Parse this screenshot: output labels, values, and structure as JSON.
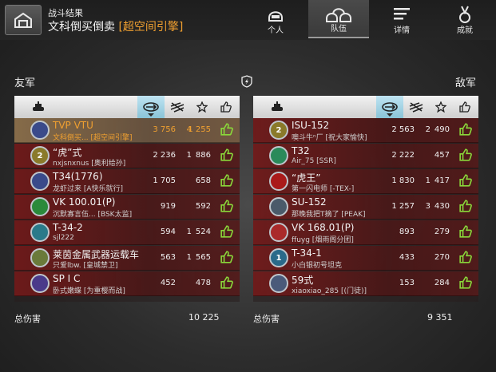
{
  "header": {
    "subtitle": "战斗结果",
    "title": "文科倒买倒卖",
    "mode": "[超空间引擎]"
  },
  "nav": [
    {
      "label": "个人",
      "icon": "single-helmet-icon",
      "active": false
    },
    {
      "label": "队伍",
      "icon": "team-helmets-icon",
      "active": true
    },
    {
      "label": "详情",
      "icon": "details-list-icon",
      "active": false
    },
    {
      "label": "成就",
      "icon": "medal-icon",
      "active": false
    }
  ],
  "allies": {
    "label": "友军",
    "total_label": "总伤害",
    "total": "10 225",
    "rows": [
      {
        "tank": "TVP VTU",
        "player": "文科倒买... [超空间引擎]",
        "damage": "3 756",
        "kills": "4",
        "score": "1 255",
        "tier": "",
        "badge_color": "#3a4a8a",
        "highlight": true
      },
      {
        "tank": "“虎”式",
        "player": "nxjsnxnus [奥利给孙]",
        "damage": "2 236",
        "kills": "1",
        "score": "886",
        "tier": "2",
        "badge_color": "#8a7a2a",
        "highlight": false
      },
      {
        "tank": "T34(1776)",
        "player": "龙虾过来 [A快乐就行]",
        "damage": "1 705",
        "kills": "",
        "score": "658",
        "tier": "",
        "badge_color": "#3a4a8a",
        "highlight": false
      },
      {
        "tank": "VK 100.01(P)",
        "player": "沉默寡言伍... [BSK太监]",
        "damage": "919",
        "kills": "",
        "score": "592",
        "tier": "",
        "badge_color": "#2a8a3a",
        "highlight": false
      },
      {
        "tank": "T-34-2",
        "player": "sjl222",
        "damage": "594",
        "kills": "1",
        "score": "524",
        "tier": "",
        "badge_color": "#2a7a8a",
        "highlight": false
      },
      {
        "tank": "莱茵金属武器运载车",
        "player": "只爱lbw. [皇城禁卫]",
        "damage": "563",
        "kills": "1",
        "score": "565",
        "tier": "",
        "badge_color": "#6a7a3a",
        "highlight": false
      },
      {
        "tank": "SP I C",
        "player": "卧式嫩蝶 [为重樱而战]",
        "damage": "452",
        "kills": "",
        "score": "478",
        "tier": "",
        "badge_color": "#4a3a8a",
        "highlight": false
      }
    ]
  },
  "enemies": {
    "label": "敌军",
    "total_label": "总伤害",
    "total": "9 351",
    "rows": [
      {
        "tank": "ISU-152",
        "player": "噢斗牛ⁿ厂 [祝大家愉快]",
        "damage": "2 563",
        "kills": "2",
        "score": "490",
        "tier": "2",
        "badge_color": "#8a7a2a",
        "highlight": false
      },
      {
        "tank": "T32",
        "player": "Air_75 [SSR]",
        "damage": "2 222",
        "kills": "",
        "score": "457",
        "tier": "",
        "badge_color": "#2a8a5a",
        "highlight": false
      },
      {
        "tank": "“虎王”",
        "player": "第一闪电师 [-TEX-]",
        "damage": "1 830",
        "kills": "1",
        "score": "417",
        "tier": "",
        "badge_color": "#aa1a1a",
        "highlight": false
      },
      {
        "tank": "SU-152",
        "player": "那晚我把T摘了 [PEAK]",
        "damage": "1 257",
        "kills": "3",
        "score": "430",
        "tier": "",
        "badge_color": "#4a5a6a",
        "highlight": false
      },
      {
        "tank": "VK 168.01(P)",
        "player": "ffuyg [烟雨阁分团]",
        "damage": "893",
        "kills": "",
        "score": "279",
        "tier": "",
        "badge_color": "#aa2a2a",
        "highlight": false
      },
      {
        "tank": "T-34-1",
        "player": "小白银初号坦克",
        "damage": "433",
        "kills": "",
        "score": "270",
        "tier": "1",
        "badge_color": "#2a6a8a",
        "highlight": false
      },
      {
        "tank": "59式",
        "player": "xiaoxiao_285 [(门徒)]",
        "damage": "153",
        "kills": "",
        "score": "284",
        "tier": "",
        "badge_color": "#4a5a7a",
        "highlight": false
      }
    ]
  },
  "columns": [
    {
      "name": "tank-column-header",
      "icon": "tank-icon",
      "selected": false
    },
    {
      "name": "damage-column-header",
      "icon": "damage-shell-icon",
      "selected": true
    },
    {
      "name": "assist-column-header",
      "icon": "assist-icon",
      "selected": false
    },
    {
      "name": "score-column-header",
      "icon": "star-icon",
      "selected": false
    },
    {
      "name": "likes-column-header",
      "icon": "thumbs-up-icon",
      "selected": false
    }
  ],
  "colors": {
    "accent": "#f0a030",
    "thumb": "#8ad83a",
    "row": "#7a1c1c",
    "highlight_row": "#8a6a4a"
  }
}
